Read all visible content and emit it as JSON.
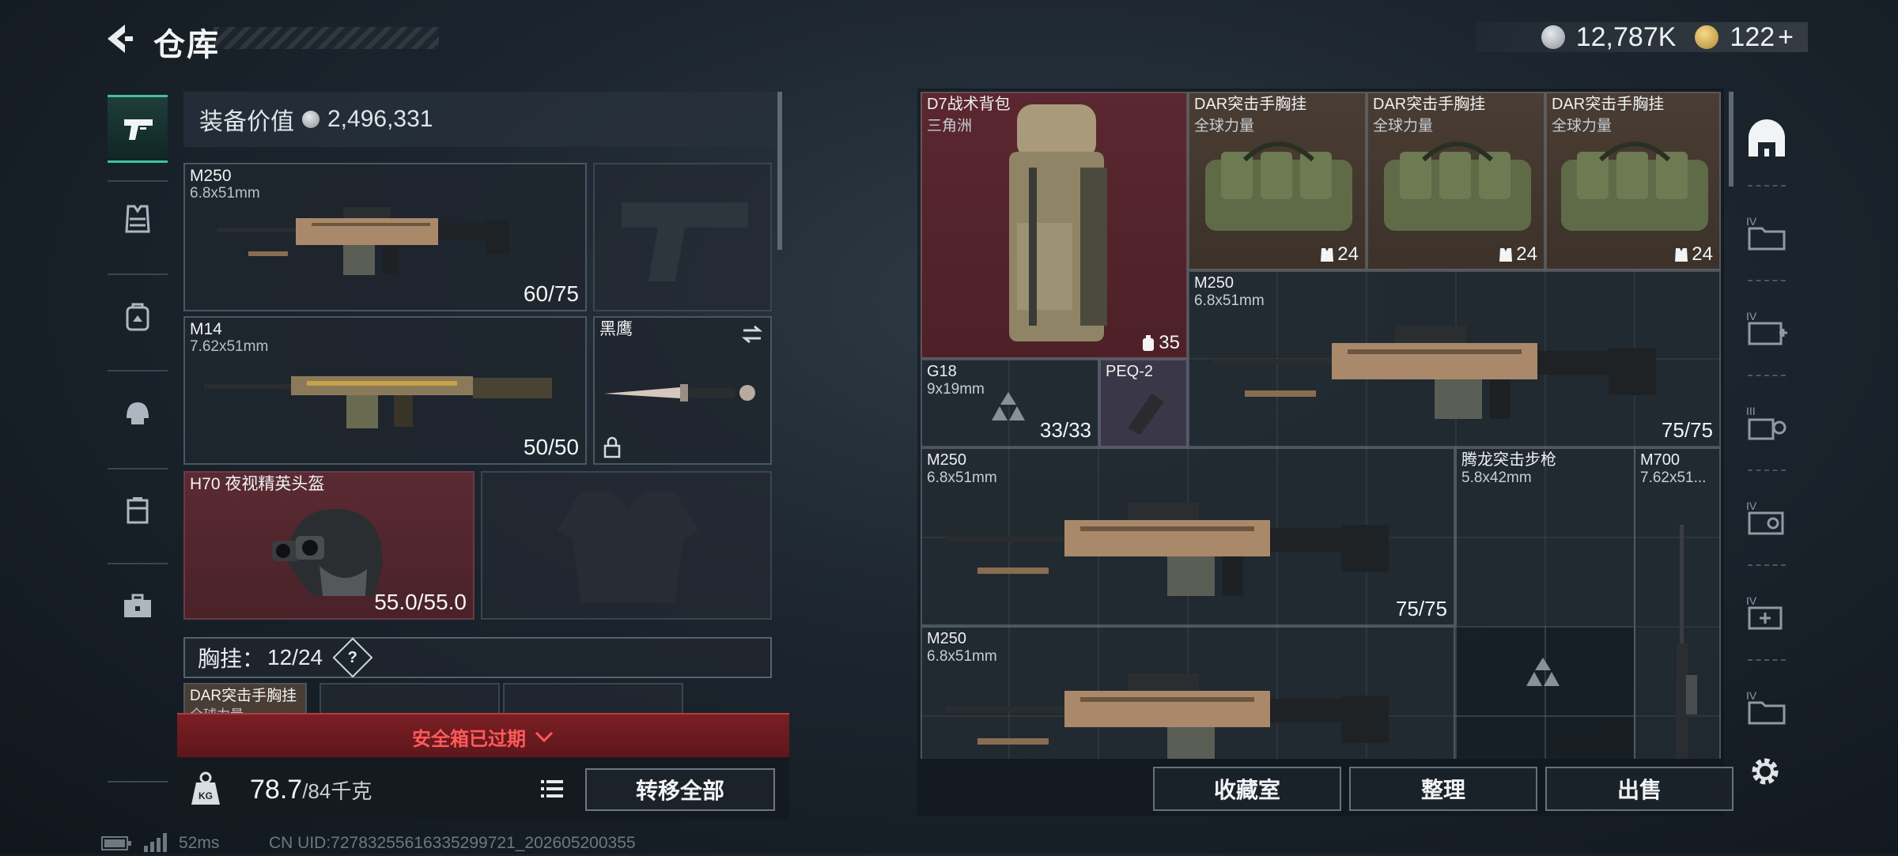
{
  "header": {
    "title": "仓库",
    "currency_silver": "12,787K",
    "currency_gold": "122",
    "currency_plus": "+"
  },
  "equipment": {
    "value_label": "装备价值",
    "value": "2,496,331",
    "primary1": {
      "name": "M250",
      "caliber": "6.8x51mm",
      "ammo": "60/75"
    },
    "primary2": {
      "name": "M14",
      "caliber": "7.62x51mm",
      "ammo": "50/50"
    },
    "melee": {
      "name": "黑鹰"
    },
    "helmet": {
      "name": "H70 夜视精英头盔",
      "durability": "55.0/55.0"
    },
    "chest_rig_label": "胸挂：",
    "chest_rig_count": "12/24",
    "chest_rig_item": "DAR突击手胸挂",
    "chest_rig_item_sub": "全球力量",
    "safe_box_text": "安全箱已过期",
    "weight": "78.7",
    "weight_max": "/84千克",
    "transfer_all": "转移全部"
  },
  "status": {
    "ping": "52ms",
    "uid": "CN UID:72783255616335299721_202605200355"
  },
  "storage": {
    "items": [
      {
        "name": "D7战术背包",
        "sub": "三角洲",
        "count": "35"
      },
      {
        "name": "DAR突击手胸挂",
        "sub": "全球力量",
        "count": "24"
      },
      {
        "name": "DAR突击手胸挂",
        "sub": "全球力量",
        "count": "24"
      },
      {
        "name": "DAR突击手胸挂",
        "sub": "全球力量",
        "count": "24"
      },
      {
        "name": "M250",
        "sub": "6.8x51mm",
        "ammo": "75/75"
      },
      {
        "name": "G18",
        "sub": "9x19mm",
        "ammo": "33/33"
      },
      {
        "name": "PEQ-2"
      },
      {
        "name": "M250",
        "sub": "6.8x51mm",
        "ammo": "75/75"
      },
      {
        "name": "腾龙突击步枪",
        "sub": "5.8x42mm"
      },
      {
        "name": "M700",
        "sub": "7.62x51..."
      },
      {
        "name": "M250",
        "sub": "6.8x51mm"
      }
    ],
    "buttons": {
      "collection": "收藏室",
      "sort": "整理",
      "sell": "出售"
    },
    "rail_tiers": [
      "IV",
      "IV",
      "III",
      "IV",
      "IV",
      "IV"
    ]
  },
  "colors": {
    "accent_teal": "#3fc1a3",
    "alert_red": "#ff5a5a",
    "item_red_bg": "#5b2730",
    "item_brown_bg": "#4a3d33"
  },
  "icons": [
    "back-arrow-icon",
    "silver-coin-icon",
    "gold-coin-icon",
    "pistol-icon",
    "vest-icon",
    "backpack-icon",
    "helmet-icon",
    "case-icon",
    "toolbox-icon",
    "weight-icon",
    "list-icon",
    "lock-icon",
    "swap-icon",
    "question-icon",
    "chevron-down-icon",
    "storage-home-icon",
    "gear-icon"
  ]
}
